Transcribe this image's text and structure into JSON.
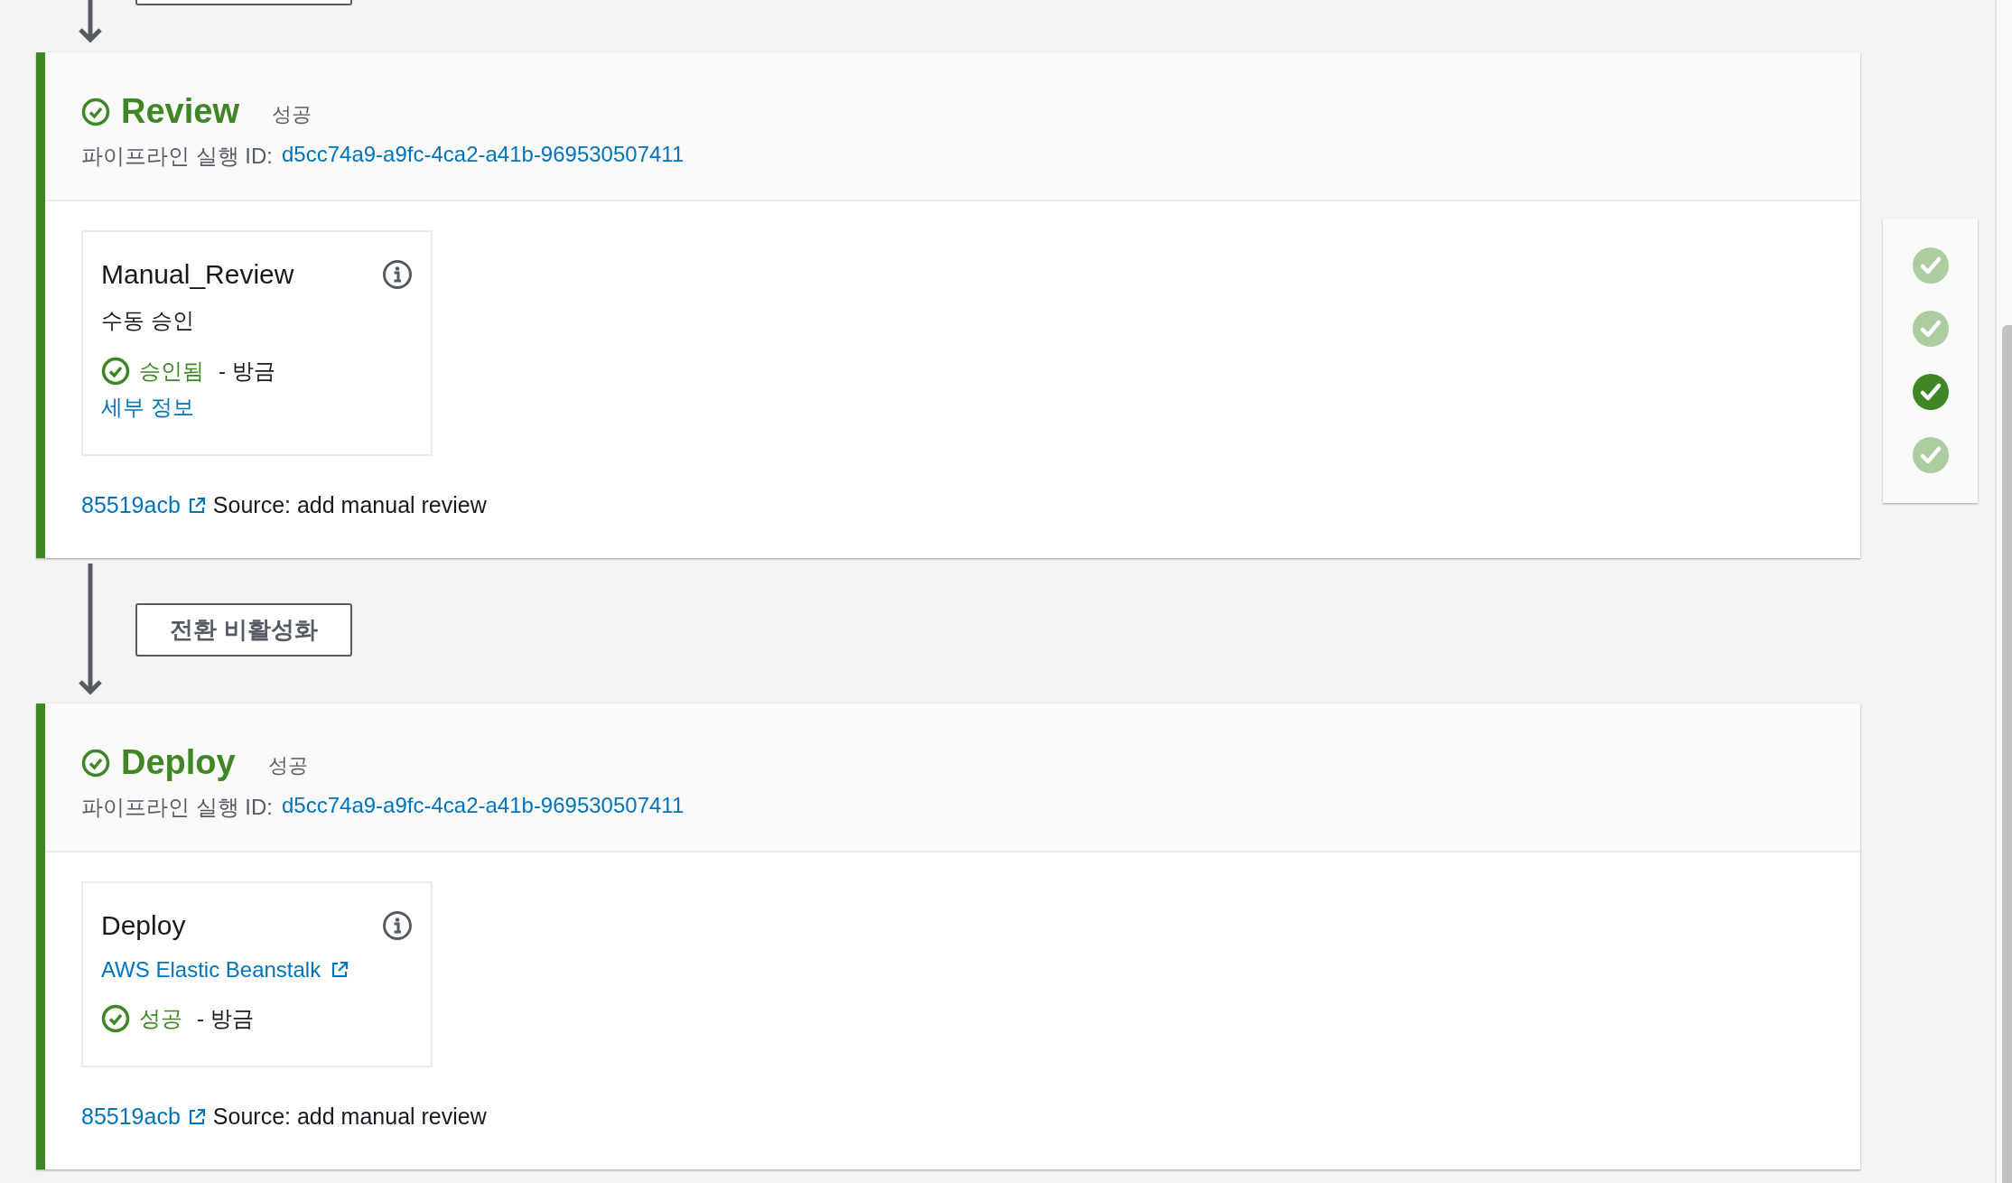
{
  "stages": [
    {
      "name": "Review",
      "status_label": "성공",
      "run_id_label": "파이프라인 실행 ID:",
      "run_id": "d5cc74a9-a9fc-4ca2-a41b-969530507411",
      "actions": [
        {
          "name": "Manual_Review",
          "provider": {
            "kind": "text",
            "label": "수동 승인"
          },
          "status_label": "승인됨",
          "time": "- 방금",
          "details_link": "세부 정보"
        }
      ],
      "commit": {
        "id": "85519acb",
        "message": "Source: add manual review"
      },
      "transition_after": {
        "label": "전환 비활성화"
      }
    },
    {
      "name": "Deploy",
      "status_label": "성공",
      "run_id_label": "파이프라인 실행 ID:",
      "run_id": "d5cc74a9-a9fc-4ca2-a41b-969530507411",
      "actions": [
        {
          "name": "Deploy",
          "provider": {
            "kind": "link",
            "label": "AWS Elastic Beanstalk"
          },
          "status_label": "성공",
          "time": "- 방금"
        }
      ],
      "commit": {
        "id": "85519acb",
        "message": "Source: add manual review"
      }
    }
  ],
  "stage_nav": [
    {
      "selected": false
    },
    {
      "selected": false
    },
    {
      "selected": true
    },
    {
      "selected": false
    }
  ]
}
